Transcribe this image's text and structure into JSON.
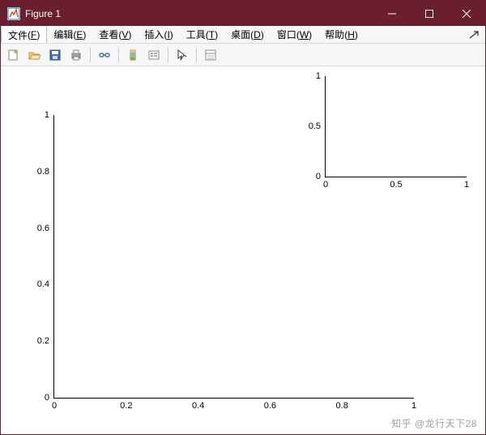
{
  "window": {
    "title": "Figure 1"
  },
  "menu": {
    "file": {
      "label": "文件",
      "acc": "F"
    },
    "edit": {
      "label": "编辑",
      "acc": "E"
    },
    "view": {
      "label": "查看",
      "acc": "V"
    },
    "insert": {
      "label": "插入",
      "acc": "I"
    },
    "tools": {
      "label": "工具",
      "acc": "T"
    },
    "desktop": {
      "label": "桌面",
      "acc": "D"
    },
    "windowm": {
      "label": "窗口",
      "acc": "W"
    },
    "help": {
      "label": "帮助",
      "acc": "H"
    }
  },
  "main_axes": {
    "yticks": [
      "0",
      "0.2",
      "0.4",
      "0.6",
      "0.8",
      "1"
    ],
    "xticks": [
      "0",
      "0.2",
      "0.4",
      "0.6",
      "0.8",
      "1"
    ]
  },
  "inset_axes": {
    "yticks": [
      "0",
      "0.5",
      "1"
    ],
    "xticks": [
      "0",
      "0.5",
      "1"
    ]
  },
  "watermark": "知乎 @龙行天下28",
  "chart_data": [
    {
      "type": "line",
      "role": "main-axes",
      "series": [],
      "xlabel": "",
      "ylabel": "",
      "xlim": [
        0,
        1
      ],
      "ylim": [
        0,
        1
      ],
      "xticks": [
        0,
        0.2,
        0.4,
        0.6,
        0.8,
        1
      ],
      "yticks": [
        0,
        0.2,
        0.4,
        0.6,
        0.8,
        1
      ]
    },
    {
      "type": "line",
      "role": "inset-axes",
      "series": [],
      "xlabel": "",
      "ylabel": "",
      "xlim": [
        0,
        1
      ],
      "ylim": [
        0,
        1
      ],
      "xticks": [
        0,
        0.5,
        1
      ],
      "yticks": [
        0,
        0.5,
        1
      ]
    }
  ]
}
